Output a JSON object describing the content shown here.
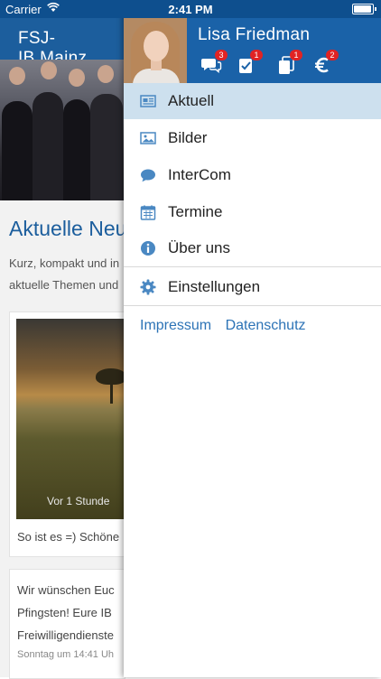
{
  "status_bar": {
    "carrier": "Carrier",
    "time": "2:41 PM"
  },
  "background": {
    "app_title": "FSJ-IB.Mainz",
    "heading": "Aktuelle Neu",
    "intro_line1": "Kurz, kompakt und in",
    "intro_line2": "aktuelle Themen und",
    "post1": {
      "time": "Vor 1 Stunde",
      "caption": "So ist es =) Schöne"
    },
    "post2": {
      "line1": "Wir wünschen Euc",
      "line2": "Pfingsten! Eure IB",
      "line3": "Freiwilligendienste",
      "time": "Sonntag um 14:41 Uh"
    }
  },
  "drawer": {
    "user_name": "Lisa Friedman",
    "badges": {
      "messages": "3",
      "tasks": "1",
      "documents": "1",
      "payments": "2"
    },
    "menu": [
      {
        "label": "Aktuell",
        "icon": "newspaper-icon"
      },
      {
        "label": "Bilder",
        "icon": "image-icon"
      },
      {
        "label": "InterCom",
        "icon": "chat-bubble-icon"
      },
      {
        "label": "Termine",
        "icon": "calendar-icon"
      },
      {
        "label": "Über uns",
        "icon": "info-icon"
      }
    ],
    "settings_label": "Einstellungen",
    "footer_links": {
      "impressum": "Impressum",
      "datenschutz": "Datenschutz"
    }
  },
  "colors": {
    "header_blue": "#1a62a8",
    "status_blue": "#0e4f8e",
    "active_row": "#cde0ee",
    "icon_blue": "#4a88c2",
    "badge_red": "#e02323",
    "link_blue": "#2c73b6"
  }
}
